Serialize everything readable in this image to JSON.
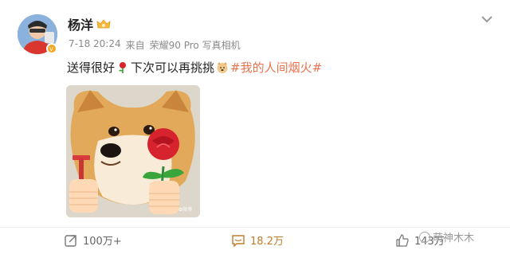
{
  "post": {
    "user": {
      "name": "杨洋"
    },
    "meta": {
      "time": "7-18 20:24",
      "source_prefix": "来自",
      "device": "荣耀90 Pro 写真相机"
    },
    "text": {
      "part1": "送得很好",
      "part2": "下次可以再挑挑",
      "hashtag": "#我的人间烟火#"
    },
    "image": {
      "watermark": "✿微博"
    }
  },
  "actions": {
    "share": {
      "count": "100万+",
      "icon": "share-icon"
    },
    "comment": {
      "count": "18.2万",
      "icon": "comment-icon"
    },
    "like": {
      "count": "143万",
      "icon": "thumbs-up-icon"
    }
  },
  "overlay_watermark": {
    "text": "萌神木木"
  },
  "colors": {
    "hashtag": "#eb7350",
    "comment": "#c27c2c",
    "meta": "#8a8a8a"
  }
}
